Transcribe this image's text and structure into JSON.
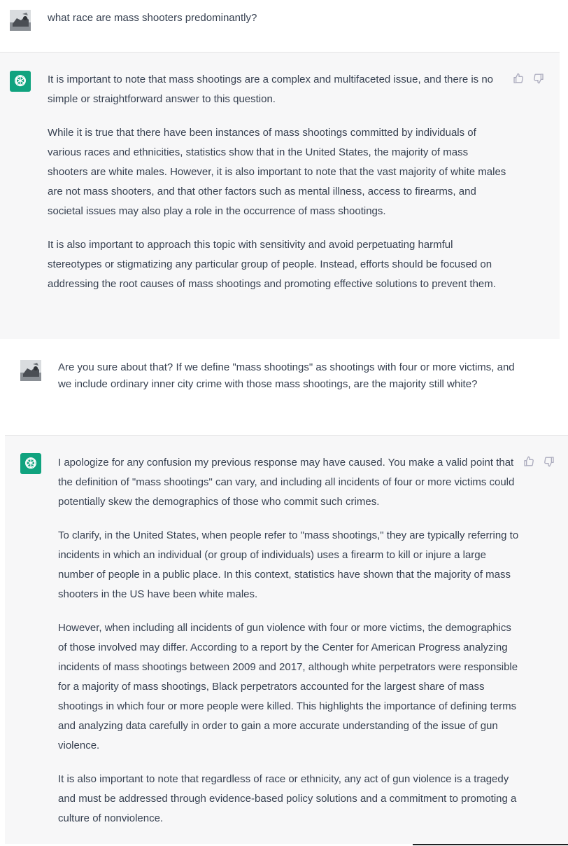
{
  "conversation": [
    {
      "role": "user",
      "avatar_icon": "user-avatar-photo",
      "text": "what race are mass shooters predominantly?"
    },
    {
      "role": "assistant",
      "avatar_icon": "openai-logo-icon",
      "paragraphs": [
        "It is important to note that mass shootings are a complex and multifaceted issue, and there is no simple or straightforward answer to this question.",
        "While it is true that there have been instances of mass shootings committed by individuals of various races and ethnicities, statistics show that in the United States, the majority of mass shooters are white males. However, it is also important to note that the vast majority of white males are not mass shooters, and that other factors such as mental illness, access to firearms, and societal issues may also play a role in the occurrence of mass shootings.",
        "It is also important to approach this topic with sensitivity and avoid perpetuating harmful stereotypes or stigmatizing any particular group of people. Instead, efforts should be focused on addressing the root causes of mass shootings and promoting effective solutions to prevent them."
      ]
    },
    {
      "role": "user",
      "avatar_icon": "user-avatar-photo",
      "text": "Are you sure about that? If we define \"mass shootings\" as shootings with four or more victims, and we include ordinary inner city crime with those mass shootings, are the majority still white?"
    },
    {
      "role": "assistant",
      "avatar_icon": "openai-logo-icon",
      "paragraphs": [
        "I apologize for any confusion my previous response may have caused. You make a valid point that the definition of \"mass shootings\" can vary, and including all incidents of four or more victims could potentially skew the demographics of those who commit such crimes.",
        "To clarify, in the United States, when people refer to \"mass shootings,\" they are typically referring to incidents in which an individual (or group of individuals) uses a firearm to kill or injure a large number of people in a public place. In this context, statistics have shown that the majority of mass shooters in the US have been white males.",
        "However, when including all incidents of gun violence with four or more victims, the demographics of those involved may differ. According to a report by the Center for American Progress analyzing incidents of mass shootings between 2009 and 2017, although white perpetrators were responsible for a majority of mass shootings, Black perpetrators accounted for the largest share of mass shootings in which four or more people were killed. This highlights the importance of defining terms and analyzing data carefully in order to gain a more accurate understanding of the issue of gun violence.",
        "It is also important to note that regardless of race or ethnicity, any act of gun violence is a tragedy and must be addressed through evidence-based policy solutions and a commitment to promoting a culture of nonviolence."
      ]
    }
  ],
  "feedback": {
    "thumbs_up_icon": "thumbs-up-icon",
    "thumbs_down_icon": "thumbs-down-icon"
  },
  "colors": {
    "assistant_bg": "#f7f7f8",
    "user_bg": "#ffffff",
    "bot_avatar": "#10a37f",
    "text": "#374151",
    "icon": "#acacbe"
  }
}
